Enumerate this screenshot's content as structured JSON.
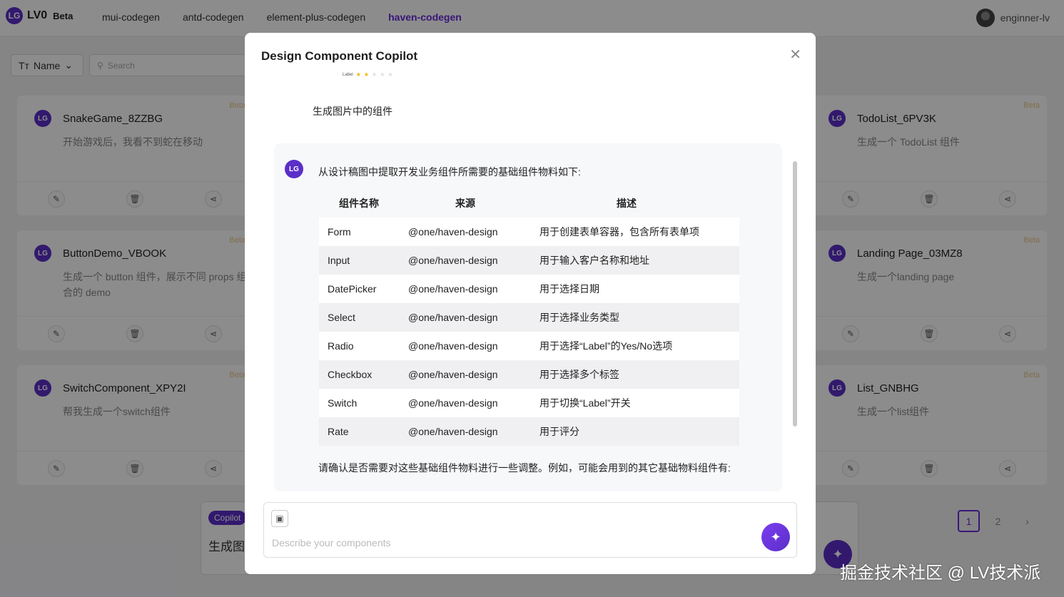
{
  "app": {
    "logo": "LG",
    "name": "LV0",
    "badge": "Beta"
  },
  "nav": {
    "tabs": [
      "mui-codegen",
      "antd-codegen",
      "element-plus-codegen",
      "haven-codegen"
    ],
    "active": "haven-codegen"
  },
  "user": {
    "name": "enginner-lv"
  },
  "filter": {
    "sort_label": "Name",
    "search_placeholder": "Search"
  },
  "cards": [
    {
      "title": "SnakeGame_8ZZBG",
      "desc": "开始游戏后，我看不到蛇在移动",
      "badge": "Beta"
    },
    {
      "title": "TodoList_6PV3K",
      "desc": "生成一个 TodoList 组件",
      "badge": "Beta"
    },
    {
      "title": "ButtonDemo_VBOOK",
      "desc": "生成一个 button 组件，展示不同 props 组合的 demo",
      "badge": "Beta"
    },
    {
      "title": "Landing Page_03MZ8",
      "desc": "生成一个landing page",
      "badge": "Beta"
    },
    {
      "title": "SwitchComponent_XPY2I",
      "desc": "帮我生成一个switch组件",
      "badge": "Beta"
    },
    {
      "title": "List_GNBHG",
      "desc": "生成一个list组件",
      "badge": "Beta"
    }
  ],
  "bg_copilot": {
    "tag": "Copilot",
    "text": "生成图"
  },
  "pager": {
    "pages": [
      "1",
      "2"
    ],
    "current": "1"
  },
  "modal": {
    "title": "Design Component Copilot",
    "preview_label": "Label",
    "preview_rating": 2,
    "user_prompt": "生成图片中的组件",
    "intro": "从设计稿图中提取开发业务组件所需要的基础组件物料如下:",
    "table_headers": [
      "组件名称",
      "来源",
      "描述"
    ],
    "rows": [
      [
        "Form",
        "@one/haven-design",
        "用于创建表单容器，包含所有表单项"
      ],
      [
        "Input",
        "@one/haven-design",
        "用于输入客户名称和地址"
      ],
      [
        "DatePicker",
        "@one/haven-design",
        "用于选择日期"
      ],
      [
        "Select",
        "@one/haven-design",
        "用于选择业务类型"
      ],
      [
        "Radio",
        "@one/haven-design",
        "用于选择“Label”的Yes/No选项"
      ],
      [
        "Checkbox",
        "@one/haven-design",
        "用于选择多个标签"
      ],
      [
        "Switch",
        "@one/haven-design",
        "用于切换“Label”开关"
      ],
      [
        "Rate",
        "@one/haven-design",
        "用于评分"
      ]
    ],
    "confirm": "请确认是否需要对这些基础组件物料进行一些调整。例如，可能会用到的其它基础物料组件有:",
    "input_placeholder": "Describe your components"
  },
  "watermark": "掘金技术社区 @ LV技术派",
  "colors": {
    "accent": "#6a2bd9",
    "brand": "#5b2fc8",
    "beta": "#e9c98a"
  }
}
